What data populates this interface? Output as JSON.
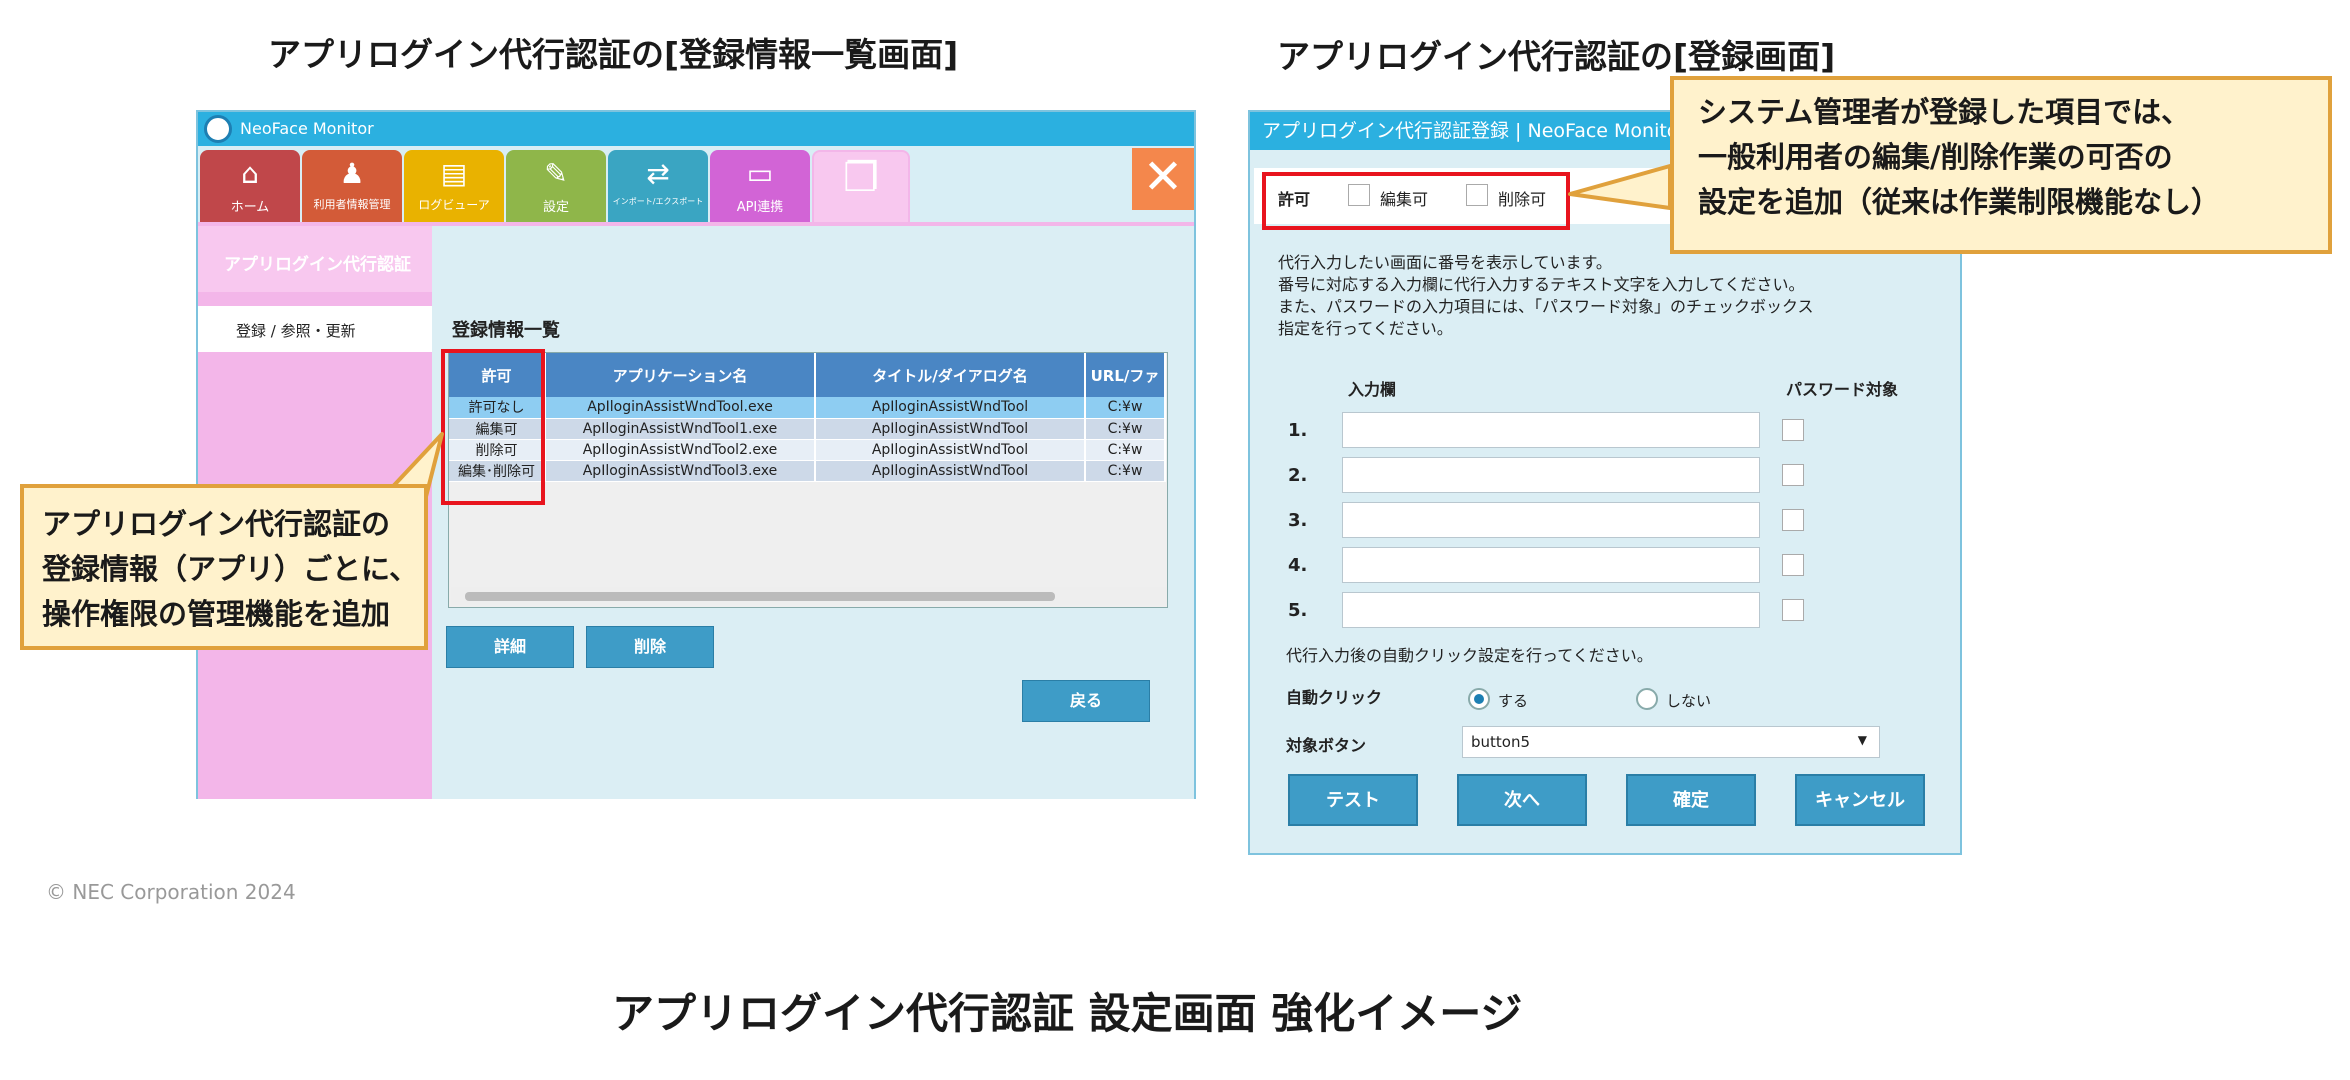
{
  "headings": {
    "left": "アプリログイン代行認証の[登録情報一覧画面]",
    "right": "アプリログイン代行認証の[登録画面]",
    "bottom": "アプリログイン代行認証 設定画面 強化イメージ"
  },
  "copyright": "© NEC Corporation 2024",
  "list_window": {
    "title": "NeoFace Monitor",
    "tabs": [
      {
        "label": "ホーム",
        "icon": "home-icon",
        "color": "#c0474a"
      },
      {
        "label": "利用者情報管理",
        "icon": "user-icon",
        "color": "#d35b38"
      },
      {
        "label": "ログビューア",
        "icon": "document-icon",
        "color": "#e9b200"
      },
      {
        "label": "設定",
        "icon": "wrench-icon",
        "color": "#8fb64a"
      },
      {
        "label": "インポート/エクスポート",
        "icon": "import-export-icon",
        "color": "#3aa5c2"
      },
      {
        "label": "API連携",
        "icon": "api-icon",
        "color": "#d264d6"
      },
      {
        "label": "",
        "icon": "windows-icon",
        "color": "#f8c8ef"
      }
    ],
    "close_label": "✕",
    "nav_header": "アプリログイン代行認証",
    "nav_item": "登録 / 参照・更新",
    "section_title": "登録情報一覧",
    "columns": [
      "許可",
      "アプリケーション名",
      "タイトル/ダイアログ名",
      "URL/ファ"
    ],
    "rows": [
      [
        "許可なし",
        "ApIloginAssistWndTool.exe",
        "ApIloginAssistWndTool",
        "C:¥w"
      ],
      [
        "編集可",
        "ApIloginAssistWndTool1.exe",
        "ApIloginAssistWndTool",
        "C:¥w"
      ],
      [
        "削除可",
        "ApIloginAssistWndTool2.exe",
        "ApIloginAssistWndTool",
        "C:¥w"
      ],
      [
        "編集･削除可",
        "ApIloginAssistWndTool3.exe",
        "ApIloginAssistWndTool",
        "C:¥w"
      ]
    ],
    "buttons": {
      "detail": "詳細",
      "delete": "削除",
      "back": "戻る"
    }
  },
  "callout_left": [
    "アプリログイン代行認証の",
    "登録情報（アプリ）ごとに、",
    "操作権限の管理機能を追加"
  ],
  "callout_right": [
    "システム管理者が登録した項目では、",
    "一般利用者の編集/削除作業の可否の",
    "設定を追加（従来は作業制限機能なし）"
  ],
  "register_window": {
    "title": "アプリログイン代行認証登録 | NeoFace Monitor",
    "perm_label": "許可",
    "perm_edit": "編集可",
    "perm_delete": "削除可",
    "instructions": [
      "代行入力したい画面に番号を表示しています。",
      "番号に対応する入力欄に代行入力するテキスト文字を入力してください。",
      "また、パスワードの入力項目には、「パスワード対象」のチェックボックス",
      "指定を行ってください。"
    ],
    "col_input": "入力欄",
    "col_password": "パスワード対象",
    "row_numbers": [
      "1.",
      "2.",
      "3.",
      "4.",
      "5."
    ],
    "auto_click_note": "代行入力後の自動クリック設定を行ってください。",
    "auto_click_label": "自動クリック",
    "radio_yes": "する",
    "radio_no": "しない",
    "auto_click_selected": "する",
    "target_button_label": "対象ボタン",
    "target_button_value": "button5",
    "buttons": [
      "テスト",
      "次へ",
      "確定",
      "キャンセル"
    ]
  }
}
